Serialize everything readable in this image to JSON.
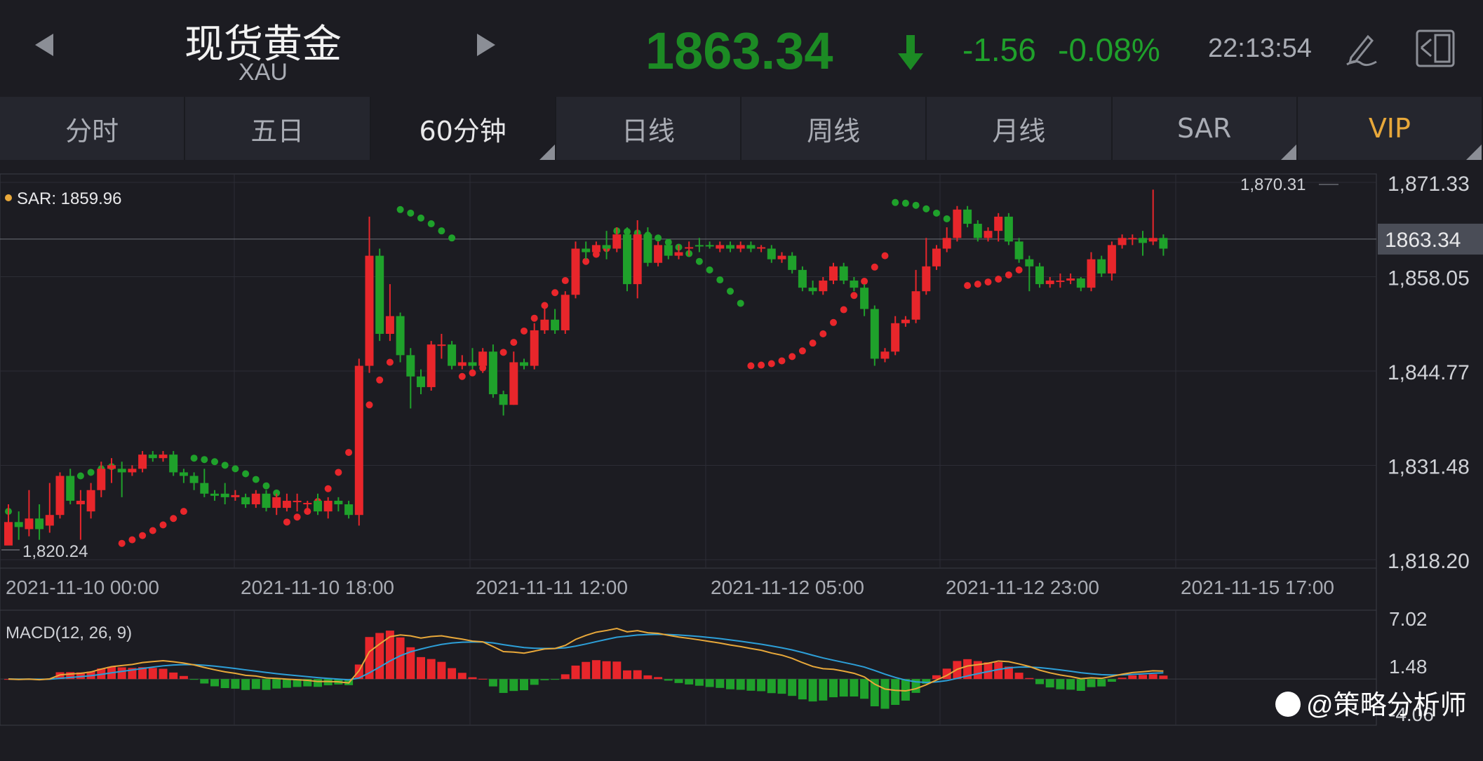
{
  "header": {
    "title": "现货黄金",
    "symbol": "XAU",
    "price": "1863.34",
    "change": "-1.56",
    "change_pct": "-0.08%",
    "time": "22:13:54",
    "icons": [
      "left-arrow-icon",
      "right-arrow-icon",
      "down-arrow-icon",
      "pen-icon",
      "layout-icon"
    ]
  },
  "tabs": [
    {
      "label": "分时"
    },
    {
      "label": "五日"
    },
    {
      "label": "60分钟",
      "active": true
    },
    {
      "label": "日线"
    },
    {
      "label": "周线"
    },
    {
      "label": "月线"
    },
    {
      "label": "SAR"
    },
    {
      "label": "VIP"
    }
  ],
  "colors": {
    "up": "#e8262b",
    "down": "#1fa12b",
    "dif_line": "#2d9fd8",
    "dea_line": "#e8a83a",
    "vip": "#e8a83a"
  },
  "chart_data": {
    "type": "candlestick",
    "indicator_label": "SAR: 1859.96",
    "y_ticks": [
      "1,871.33",
      "1,858.05",
      "1,844.77",
      "1,831.48",
      "1,818.20"
    ],
    "y_range": [
      1818.2,
      1871.33
    ],
    "current_price_label": "1863.34",
    "high_label": "1,870.31",
    "low_label": "1,820.24",
    "x_ticks": [
      "2021-11-10 00:00",
      "2021-11-10 18:00",
      "2021-11-11 12:00",
      "2021-11-12 05:00",
      "2021-11-12 23:00",
      "2021-11-15 17:00"
    ],
    "candles": [
      [
        1820.2,
        1823.5,
        1822.0,
        1826.0
      ],
      [
        1823.5,
        1822.8,
        1821.0,
        1825.0
      ],
      [
        1822.5,
        1824.0,
        1821.5,
        1828.0
      ],
      [
        1824.0,
        1822.5,
        1821.0,
        1826.0
      ],
      [
        1823.0,
        1824.5,
        1822.0,
        1829.0
      ],
      [
        1824.5,
        1830.0,
        1824.0,
        1830.5
      ],
      [
        1830.0,
        1826.5,
        1826.0,
        1831.0
      ],
      [
        1826.0,
        1826.5,
        1821.0,
        1828.0
      ],
      [
        1825.0,
        1828.0,
        1824.0,
        1829.0
      ],
      [
        1828.0,
        1831.0,
        1827.0,
        1832.0
      ],
      [
        1831.0,
        1831.5,
        1829.0,
        1832.5
      ],
      [
        1831.0,
        1830.5,
        1827.0,
        1832.0
      ],
      [
        1830.5,
        1831.0,
        1830.0,
        1831.5
      ],
      [
        1831.0,
        1833.0,
        1830.5,
        1833.5
      ],
      [
        1833.0,
        1832.5,
        1832.0,
        1833.5
      ],
      [
        1832.5,
        1833.0,
        1832.0,
        1833.5
      ],
      [
        1833.0,
        1830.5,
        1830.0,
        1833.5
      ],
      [
        1830.5,
        1830.0,
        1829.0,
        1831.0
      ],
      [
        1830.0,
        1829.0,
        1828.0,
        1830.5
      ],
      [
        1829.0,
        1827.5,
        1827.0,
        1831.0
      ],
      [
        1827.5,
        1827.2,
        1826.5,
        1828.0
      ],
      [
        1827.5,
        1827.0,
        1826.0,
        1829.0
      ],
      [
        1827.0,
        1827.3,
        1826.5,
        1828.0
      ],
      [
        1827.0,
        1826.0,
        1825.5,
        1827.5
      ],
      [
        1826.0,
        1827.5,
        1825.5,
        1828.0
      ],
      [
        1827.5,
        1825.5,
        1825.0,
        1828.0
      ],
      [
        1825.5,
        1827.0,
        1824.5,
        1827.5
      ],
      [
        1825.5,
        1826.5,
        1825.0,
        1827.5
      ],
      [
        1826.5,
        1826.5,
        1825.0,
        1827.5
      ],
      [
        1826.0,
        1826.2,
        1825.0,
        1826.5
      ],
      [
        1826.5,
        1825.0,
        1824.5,
        1827.5
      ],
      [
        1825.0,
        1826.5,
        1824.0,
        1827.0
      ],
      [
        1826.5,
        1826.0,
        1825.0,
        1827.0
      ],
      [
        1826.0,
        1824.5,
        1824.0,
        1826.5
      ],
      [
        1824.5,
        1845.5,
        1823.0,
        1846.5
      ],
      [
        1845.5,
        1861.0,
        1844.5,
        1866.5
      ],
      [
        1861.0,
        1850.0,
        1849.0,
        1862.0
      ],
      [
        1850.0,
        1852.5,
        1849.0,
        1857.0
      ],
      [
        1852.5,
        1847.0,
        1846.0,
        1853.0
      ],
      [
        1847.0,
        1844.0,
        1839.5,
        1848.0
      ],
      [
        1844.0,
        1842.5,
        1841.5,
        1845.0
      ],
      [
        1842.5,
        1848.5,
        1842.0,
        1849.0
      ],
      [
        1848.5,
        1848.5,
        1846.5,
        1850.0
      ],
      [
        1848.5,
        1845.5,
        1845.0,
        1849.0
      ],
      [
        1845.5,
        1846.0,
        1845.0,
        1847.0
      ],
      [
        1846.0,
        1845.5,
        1845.0,
        1848.0
      ],
      [
        1845.5,
        1847.5,
        1844.5,
        1848.0
      ],
      [
        1847.5,
        1841.5,
        1841.0,
        1848.5
      ],
      [
        1841.5,
        1840.0,
        1838.5,
        1842.0
      ],
      [
        1840.0,
        1846.0,
        1840.0,
        1847.5
      ],
      [
        1846.0,
        1845.5,
        1845.0,
        1846.5
      ],
      [
        1845.5,
        1850.5,
        1845.0,
        1851.5
      ],
      [
        1850.5,
        1852.0,
        1850.0,
        1854.0
      ],
      [
        1852.0,
        1850.5,
        1850.0,
        1853.5
      ],
      [
        1850.5,
        1855.5,
        1850.0,
        1856.0
      ],
      [
        1855.5,
        1862.0,
        1855.0,
        1863.0
      ],
      [
        1862.0,
        1861.5,
        1860.5,
        1863.0
      ],
      [
        1861.5,
        1862.5,
        1861.0,
        1863.0
      ],
      [
        1862.5,
        1862.0,
        1860.5,
        1864.5
      ],
      [
        1862.0,
        1864.0,
        1861.5,
        1865.0
      ],
      [
        1864.0,
        1857.0,
        1856.0,
        1865.0
      ],
      [
        1857.0,
        1864.0,
        1855.0,
        1866.0
      ],
      [
        1864.0,
        1860.0,
        1859.5,
        1865.0
      ],
      [
        1860.0,
        1862.5,
        1859.5,
        1863.0
      ],
      [
        1862.5,
        1861.0,
        1860.5,
        1863.0
      ],
      [
        1861.0,
        1861.5,
        1860.5,
        1862.5
      ],
      [
        1862.0,
        1862.2,
        1861.0,
        1863.0
      ],
      [
        1862.5,
        1862.3,
        1861.5,
        1863.5
      ],
      [
        1862.5,
        1862.3,
        1862.0,
        1863.0
      ],
      [
        1862.0,
        1862.5,
        1861.5,
        1863.0
      ],
      [
        1862.5,
        1862.0,
        1861.5,
        1863.0
      ],
      [
        1862.0,
        1862.5,
        1861.5,
        1863.0
      ],
      [
        1862.5,
        1862.0,
        1861.5,
        1863.0
      ],
      [
        1862.0,
        1862.2,
        1861.5,
        1862.5
      ],
      [
        1862.0,
        1860.5,
        1860.0,
        1862.5
      ],
      [
        1860.5,
        1861.0,
        1860.0,
        1861.5
      ],
      [
        1861.0,
        1859.0,
        1858.5,
        1861.5
      ],
      [
        1859.0,
        1856.5,
        1856.0,
        1859.5
      ],
      [
        1856.5,
        1856.0,
        1855.5,
        1857.5
      ],
      [
        1856.0,
        1857.5,
        1855.5,
        1858.0
      ],
      [
        1857.5,
        1859.5,
        1857.0,
        1860.0
      ],
      [
        1859.5,
        1857.5,
        1857.0,
        1860.0
      ],
      [
        1857.5,
        1856.5,
        1856.0,
        1858.0
      ],
      [
        1856.5,
        1853.5,
        1852.5,
        1857.0
      ],
      [
        1853.5,
        1846.5,
        1845.5,
        1854.0
      ],
      [
        1846.5,
        1847.5,
        1846.0,
        1848.0
      ],
      [
        1847.5,
        1851.5,
        1847.0,
        1852.5
      ],
      [
        1851.5,
        1852.0,
        1851.0,
        1852.5
      ],
      [
        1852.0,
        1856.0,
        1851.5,
        1859.0
      ],
      [
        1856.0,
        1859.5,
        1855.5,
        1863.5
      ],
      [
        1859.5,
        1862.0,
        1859.0,
        1862.5
      ],
      [
        1862.0,
        1863.5,
        1861.5,
        1865.0
      ],
      [
        1863.5,
        1867.5,
        1863.0,
        1868.0
      ],
      [
        1867.5,
        1865.5,
        1865.0,
        1868.0
      ],
      [
        1865.5,
        1863.5,
        1863.0,
        1866.0
      ],
      [
        1863.5,
        1864.5,
        1863.0,
        1865.0
      ],
      [
        1864.5,
        1866.5,
        1863.0,
        1867.0
      ],
      [
        1866.5,
        1863.0,
        1862.5,
        1867.0
      ],
      [
        1863.0,
        1860.5,
        1860.0,
        1863.5
      ],
      [
        1860.5,
        1859.5,
        1856.0,
        1861.0
      ],
      [
        1859.5,
        1857.0,
        1856.5,
        1860.0
      ],
      [
        1857.0,
        1857.5,
        1856.5,
        1858.0
      ],
      [
        1857.5,
        1857.5,
        1856.5,
        1858.5
      ],
      [
        1857.5,
        1857.8,
        1857.0,
        1858.5
      ],
      [
        1857.8,
        1856.5,
        1856.0,
        1858.0
      ],
      [
        1856.5,
        1860.5,
        1856.0,
        1861.5
      ],
      [
        1860.5,
        1858.5,
        1858.0,
        1861.0
      ],
      [
        1858.5,
        1862.5,
        1857.5,
        1863.0
      ],
      [
        1862.5,
        1863.5,
        1862.0,
        1864.0
      ],
      [
        1863.5,
        1863.5,
        1862.5,
        1864.0
      ],
      [
        1863.5,
        1862.8,
        1861.0,
        1864.5
      ],
      [
        1863.0,
        1863.5,
        1862.5,
        1870.3
      ],
      [
        1863.5,
        1862.0,
        1861.0,
        1864.0
      ]
    ],
    "sar_dots": [
      [
        0,
        1825.0,
        "g"
      ],
      [
        7,
        1830.0,
        "g"
      ],
      [
        8,
        1830.5,
        "g"
      ],
      [
        9,
        1831.0,
        "g"
      ],
      [
        10,
        1831.3,
        "g"
      ],
      [
        11,
        1820.5,
        "r"
      ],
      [
        12,
        1821.0,
        "r"
      ],
      [
        13,
        1821.6,
        "r"
      ],
      [
        14,
        1822.3,
        "r"
      ],
      [
        15,
        1823.1,
        "r"
      ],
      [
        16,
        1824.0,
        "r"
      ],
      [
        17,
        1825.0,
        "r"
      ],
      [
        18,
        1832.5,
        "g"
      ],
      [
        19,
        1832.3,
        "g"
      ],
      [
        20,
        1832.0,
        "g"
      ],
      [
        21,
        1831.5,
        "g"
      ],
      [
        22,
        1831.0,
        "g"
      ],
      [
        23,
        1830.3,
        "g"
      ],
      [
        24,
        1829.5,
        "g"
      ],
      [
        25,
        1828.6,
        "g"
      ],
      [
        26,
        1827.6,
        "g"
      ],
      [
        27,
        1823.5,
        "r"
      ],
      [
        28,
        1824.2,
        "r"
      ],
      [
        29,
        1825.0,
        "r"
      ],
      [
        30,
        1826.4,
        "r"
      ],
      [
        31,
        1828.2,
        "r"
      ],
      [
        32,
        1830.5,
        "r"
      ],
      [
        33,
        1833.3,
        "r"
      ],
      [
        34,
        1836.5,
        "r"
      ],
      [
        35,
        1840.0,
        "r"
      ],
      [
        36,
        1843.5,
        "r"
      ],
      [
        37,
        1846.0,
        "r"
      ],
      [
        38,
        1867.5,
        "g"
      ],
      [
        39,
        1867.0,
        "g"
      ],
      [
        40,
        1866.3,
        "g"
      ],
      [
        41,
        1865.5,
        "g"
      ],
      [
        42,
        1864.5,
        "g"
      ],
      [
        43,
        1863.5,
        "g"
      ],
      [
        44,
        1844.0,
        "r"
      ],
      [
        45,
        1844.5,
        "r"
      ],
      [
        46,
        1845.2,
        "r"
      ],
      [
        47,
        1846.2,
        "r"
      ],
      [
        48,
        1847.4,
        "r"
      ],
      [
        49,
        1848.8,
        "r"
      ],
      [
        50,
        1850.4,
        "r"
      ],
      [
        51,
        1852.2,
        "r"
      ],
      [
        52,
        1854.0,
        "r"
      ],
      [
        53,
        1855.8,
        "r"
      ],
      [
        54,
        1857.5,
        "r"
      ],
      [
        55,
        1859.0,
        "r"
      ],
      [
        56,
        1860.2,
        "r"
      ],
      [
        57,
        1861.2,
        "r"
      ],
      [
        58,
        1862.0,
        "r"
      ],
      [
        59,
        1864.5,
        "g"
      ],
      [
        60,
        1864.4,
        "g"
      ],
      [
        61,
        1864.2,
        "g"
      ],
      [
        62,
        1863.9,
        "g"
      ],
      [
        63,
        1863.5,
        "g"
      ],
      [
        64,
        1862.9,
        "g"
      ],
      [
        65,
        1862.2,
        "g"
      ],
      [
        66,
        1861.3,
        "g"
      ],
      [
        67,
        1860.2,
        "g"
      ],
      [
        68,
        1859.0,
        "g"
      ],
      [
        69,
        1857.6,
        "g"
      ],
      [
        70,
        1856.0,
        "g"
      ],
      [
        71,
        1854.3,
        "g"
      ],
      [
        72,
        1845.5,
        "r"
      ],
      [
        73,
        1845.6,
        "r"
      ],
      [
        74,
        1845.8,
        "r"
      ],
      [
        75,
        1846.2,
        "r"
      ],
      [
        76,
        1846.8,
        "r"
      ],
      [
        77,
        1847.6,
        "r"
      ],
      [
        78,
        1848.7,
        "r"
      ],
      [
        79,
        1850.0,
        "r"
      ],
      [
        80,
        1851.6,
        "r"
      ],
      [
        81,
        1853.4,
        "r"
      ],
      [
        82,
        1855.4,
        "r"
      ],
      [
        83,
        1857.4,
        "r"
      ],
      [
        84,
        1859.4,
        "r"
      ],
      [
        85,
        1861.0,
        "r"
      ],
      [
        86,
        1868.5,
        "g"
      ],
      [
        87,
        1868.4,
        "g"
      ],
      [
        88,
        1868.1,
        "g"
      ],
      [
        89,
        1867.6,
        "g"
      ],
      [
        90,
        1867.0,
        "g"
      ],
      [
        91,
        1866.2,
        "g"
      ],
      [
        92,
        1865.3,
        "g"
      ],
      [
        93,
        1856.8,
        "r"
      ],
      [
        94,
        1857.0,
        "r"
      ],
      [
        95,
        1857.3,
        "r"
      ],
      [
        96,
        1857.7,
        "r"
      ],
      [
        97,
        1858.3,
        "r"
      ],
      [
        98,
        1859.0,
        "r"
      ],
      [
        99,
        1860.0,
        "r"
      ]
    ],
    "macd": {
      "label": "MACD(12, 26, 9)",
      "y_ticks": [
        "7.02",
        "1.48",
        "-4.06"
      ],
      "y_range": [
        -4.06,
        7.02
      ]
    }
  },
  "footer": {
    "watermark": "@策略分析师"
  }
}
